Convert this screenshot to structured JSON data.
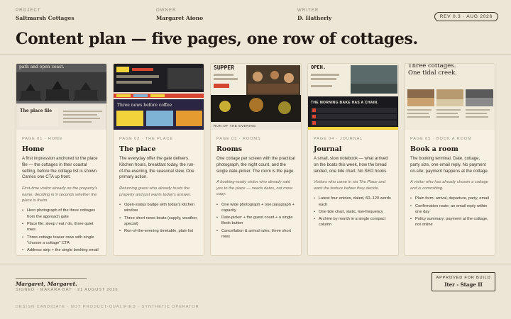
{
  "header": {
    "project_label": "PROJECT",
    "project_value": "Saltmarsh Cottages",
    "owner_label": "OWNER",
    "owner_value": "Margaret Aiono",
    "writer_label": "WRITER",
    "writer_value": "D. Hatherly",
    "rev_badge": "REV 0.3 · AUG 2026"
  },
  "title": "Content plan — five pages, one row of cottages.",
  "cards": [
    {
      "page_label": "PAGE 01 · HOME",
      "title": "Home",
      "desc": "A first impression anchored to the place file — the cottages in their coastal setting, before the cottage list is shown. Carries one CTA up front.",
      "visitor": "First-time visitor already on the property's name, deciding in 9 seconds whether the place is theirs.",
      "items": [
        "Hero photograph of the three cottages from the approach gate",
        "Place file: sleep / eat / do, three quiet rows",
        "Three-cottage teaser rows with single \"choose a cottage\" CTA",
        "Address strip + the single booking email"
      ],
      "thumb_texts": [
        "path and open coast.",
        "The place file"
      ]
    },
    {
      "page_label": "PAGE 02 · THE PLACE",
      "title": "The place",
      "desc": "The everyday offer the gate delivers. Kitchen hours, breakfast today, the run-of-the-evening, the seasonal stew. One primary action.",
      "visitor": "Returning guest who already trusts the property and just wants today's answer.",
      "items": [
        "Open-status badge with today's kitchen window",
        "Three short news beats (supply, weather, special)",
        "Run-of-the-evening timetable, plain list"
      ],
      "thumb_texts": [
        "Three news before coffee"
      ]
    },
    {
      "page_label": "PAGE 03 · ROOMS",
      "title": "Rooms",
      "desc": "One cottage per screen with the practical photograph, the night count, and the single date-picker. The room is the page.",
      "visitor": "A booking-ready visitor who already said yes to the place — needs dates, not more copy.",
      "items": [
        "One wide photograph + one paragraph + capacity",
        "Date-picker + the guest count + a single Book button",
        "Cancellation & arrival rules, three short rows"
      ],
      "thumb_texts": [
        "SUPPER",
        "RUN OF THE EVENING"
      ]
    },
    {
      "page_label": "PAGE 04 · JOURNAL",
      "title": "Journal",
      "desc": "A small, slow notebook — what arrived on the boats this week, how the bread landed, one tide chart. No SEO hooks.",
      "visitor": "Visitors who came in via The Place and want the texture before they decide.",
      "items": [
        "Latest four entries, dated, 60–120 words each",
        "One tide chart, static, low-frequency",
        "Archive by month in a single compact column"
      ],
      "thumb_texts": [
        "OPEN.",
        "THE MORNING BAKE HAS A CHAIN."
      ]
    },
    {
      "page_label": "PAGE 05 · BOOK A ROOM",
      "title": "Book a room",
      "desc": "The booking terminal. Date, cottage, party size, one email reply. No payment on-site; payment happens at the cottage.",
      "visitor": "A visitor who has already chosen a cottage and is committing.",
      "items": [
        "Plain form: arrival, departure, party, email",
        "Confirmation route: an email reply within one day",
        "Policy summary: payment at the cottage, not online"
      ],
      "thumb_texts": [
        "Three cottages.",
        "One tidal creek."
      ]
    }
  ],
  "footer": {
    "signature": "Margaret, Margaret.",
    "signed_meta": "SIGNED · MAKARA BAY · 21 AUGUST 2026",
    "bottom_meta": "DESIGN CANDIDATE · NOT PRODUCT-QUALIFIED · SYNTHETIC OPERATOR",
    "stamp_top": "APPROVED FOR BUILD",
    "stamp_bottom": "Iter - Stage II"
  },
  "colors": {
    "background": "#ece6d6",
    "card": "#f6f1e3",
    "ink": "#2a251d",
    "accent_yellow": "#f2d33a",
    "accent_red": "#d6452f",
    "accent_blue": "#7fb3d5"
  }
}
